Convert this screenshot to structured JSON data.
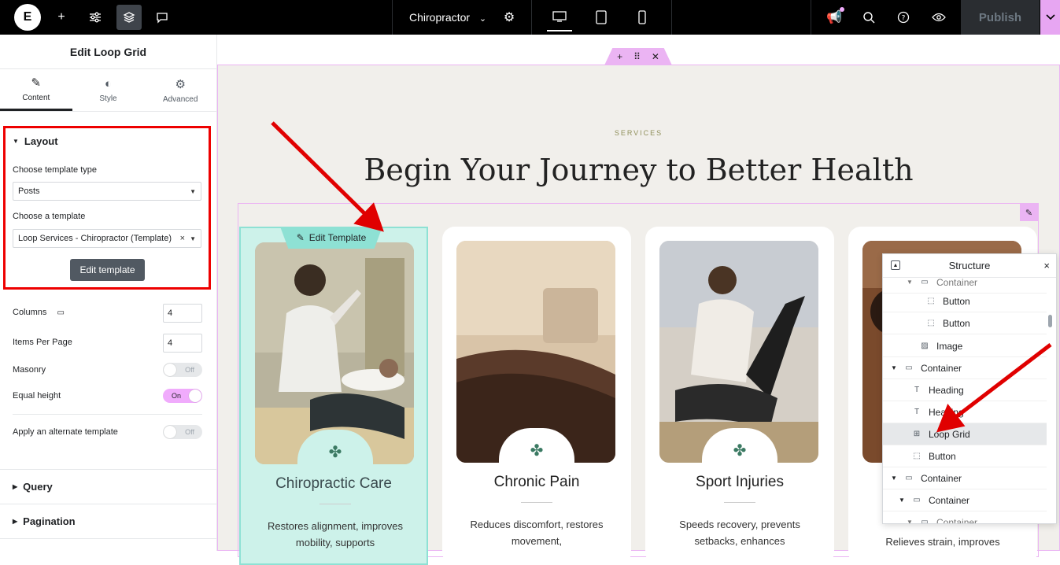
{
  "topbar": {
    "logo_letter": "E",
    "page_name": "Chiropractor",
    "publish_label": "Publish"
  },
  "panel": {
    "title": "Edit Loop Grid",
    "tabs": [
      {
        "label": "Content",
        "icon": "pencil-icon"
      },
      {
        "label": "Style",
        "icon": "half-circle-icon"
      },
      {
        "label": "Advanced",
        "icon": "gear-icon"
      }
    ],
    "layout": {
      "heading": "Layout",
      "template_type_label": "Choose template type",
      "template_type_value": "Posts",
      "template_label": "Choose a template",
      "template_value": "Loop Services - Chiropractor (Template)",
      "edit_button": "Edit template"
    },
    "columns_label": "Columns",
    "columns_value": "4",
    "items_per_page_label": "Items Per Page",
    "items_per_page_value": "4",
    "masonry_label": "Masonry",
    "masonry_state": "Off",
    "equal_height_label": "Equal height",
    "equal_height_state": "On",
    "alternate_label": "Apply an alternate template",
    "alternate_state": "Off",
    "query_label": "Query",
    "pagination_label": "Pagination"
  },
  "canvas": {
    "eyebrow": "SERVICES",
    "heading": "Begin Your Journey to Better Health",
    "edit_template_label": "Edit Template",
    "cards": [
      {
        "title": "Chiropractic Care",
        "desc": "Restores alignment, improves mobility, supports"
      },
      {
        "title": "Chronic Pain",
        "desc": "Reduces discomfort, restores movement,"
      },
      {
        "title": "Sport Injuries",
        "desc": "Speeds recovery, prevents setbacks, enhances"
      },
      {
        "title": "",
        "desc": "Relieves strain, improves"
      }
    ]
  },
  "structure": {
    "title": "Structure",
    "rows": [
      {
        "label": "Container",
        "icon": "container-icon"
      },
      {
        "label": "Button",
        "icon": "button-icon"
      },
      {
        "label": "Button",
        "icon": "button-icon"
      },
      {
        "label": "Image",
        "icon": "image-icon"
      },
      {
        "label": "Container",
        "icon": "container-icon"
      },
      {
        "label": "Heading",
        "icon": "heading-icon"
      },
      {
        "label": "Heading",
        "icon": "heading-icon"
      },
      {
        "label": "Loop Grid",
        "icon": "loop-grid-icon"
      },
      {
        "label": "Button",
        "icon": "button-icon"
      },
      {
        "label": "Container",
        "icon": "container-icon"
      },
      {
        "label": "Container",
        "icon": "container-icon"
      },
      {
        "label": "Container",
        "icon": "container-icon"
      }
    ]
  },
  "colors": {
    "accent_pink": "#ebb4f3",
    "teal_highlight": "#8ee1d4",
    "annotation_red": "#e00000"
  }
}
